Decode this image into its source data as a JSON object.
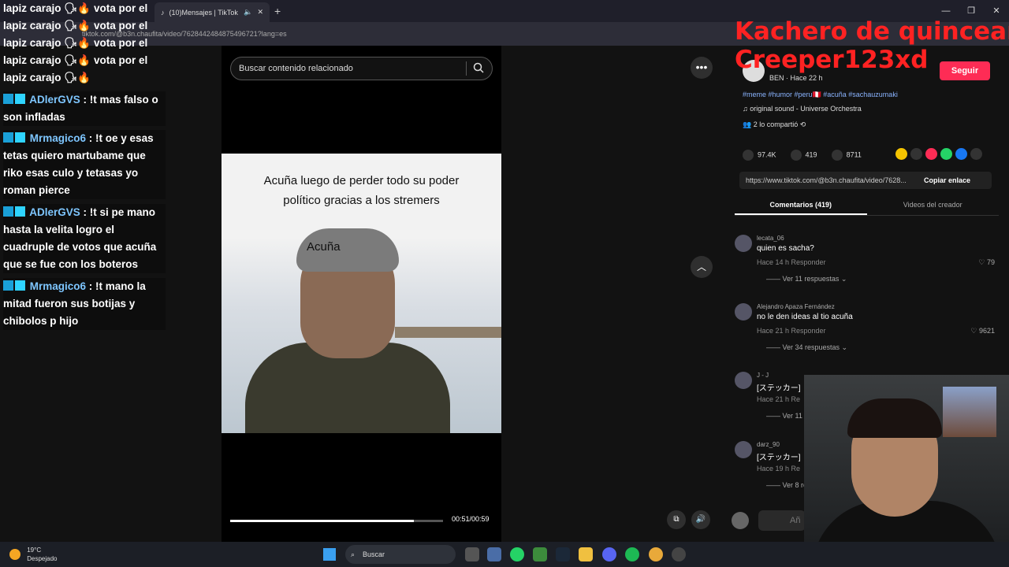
{
  "browser": {
    "tab_title": "(10)Mensajes | TikTok",
    "url": "tiktok.com/@b3n.chaufita/video/7628442484875496721?lang=es",
    "new_tab": "+",
    "window_controls": [
      "—",
      "❐",
      "✕"
    ]
  },
  "video": {
    "search_placeholder": "Buscar contenido relacionado",
    "caption": "Acuña luego de perder todo su poder político gracias a los stremers",
    "name_label": "Acuña",
    "progress": 0.8644,
    "time": "00:51/00:59"
  },
  "author": {
    "name": "b3n.chaufita",
    "meta": "BEN · Hace 22 h",
    "follow_label": "Seguir",
    "tags": "#meme #humor #peru🇵🇪 #acuña #sachauzumaki",
    "sound": "♫  original sound - Universe Orchestra",
    "shared": "2 lo compartió"
  },
  "stats": {
    "likes": "97.4K",
    "comments": "419",
    "saves": "8711"
  },
  "share": {
    "link": "https://www.tiktok.com/@b3n.chaufita/video/7628...",
    "copy_label": "Copiar enlace"
  },
  "tabs": {
    "comments": "Comentarios (419)",
    "creator": "Videos del creador"
  },
  "comments": [
    {
      "user": "lecata_06",
      "text": "quien es sacha?",
      "meta": "Hace 14 h    Responder",
      "likes": "♡ 79",
      "replies": "——  Ver 11 respuestas  ⌄"
    },
    {
      "user": "Alejandro Apaza Fernández",
      "text": "no le den ideas al tio acuña",
      "meta": "Hace 21 h    Responder",
      "likes": "♡ 9621",
      "replies": "——  Ver 34 respuestas  ⌄"
    },
    {
      "user": "J - J",
      "text": "[ステッカー]",
      "meta": "Hace 21 h    Re",
      "likes": "",
      "replies": "——  Ver 11 re"
    },
    {
      "user": "darz_90",
      "text": "[ステッカー]",
      "meta": "Hace 19 h    Re",
      "likes": "",
      "replies": "——  Ver 8 re"
    }
  ],
  "comment_input_placeholder": "Añ",
  "chat": {
    "top_lines": [
      "lapiz carajo 🗣🔥 vota por el",
      "lapiz carajo 🗣🔥 vota por el",
      "lapiz carajo 🗣🔥 vota por el",
      "lapiz carajo 🗣🔥 vota por el",
      "lapiz carajo 🗣🔥"
    ],
    "messages": [
      {
        "name": "ADlerGVS",
        "text": " : !t mas falso o son infladas"
      },
      {
        "name": "Mrmagico6",
        "text": " : !t oe y esas tetas quiero martubame que riko esas culo y tetasas yo roman pierce"
      },
      {
        "name": "ADlerGVS",
        "text": " : !t si pe mano hasta la velita logro el cuadruple de votos que acuña que se fue con los boteros"
      },
      {
        "name": "Mrmagico6",
        "text": " : !t mano la mitad fueron sus botijas y chibolos p hijo"
      }
    ]
  },
  "overlay": {
    "line1": "Kachero de quinceañ",
    "line2": "Creeper123xd",
    "color": "#ff2222"
  },
  "taskbar": {
    "temp": "19°C",
    "weather": "Despejado",
    "search": "Buscar"
  }
}
